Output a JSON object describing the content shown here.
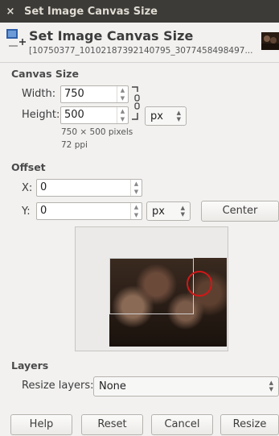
{
  "window": {
    "title": "Set Image Canvas Size",
    "close_glyph": "×"
  },
  "header": {
    "title": "Set Image Canvas Size",
    "subtitle": "[10750377_10102187392140795_3077458498497..."
  },
  "canvas_size": {
    "section_title": "Canvas Size",
    "width_label": "Width:",
    "width_value": "750",
    "height_label": "Height:",
    "height_value": "500",
    "unit": "px",
    "info_pixels": "750 × 500 pixels",
    "info_ppi": "72 ppi"
  },
  "offset": {
    "section_title": "Offset",
    "x_label": "X:",
    "x_value": "0",
    "y_label": "Y:",
    "y_value": "0",
    "unit": "px",
    "center_label": "Center"
  },
  "layers": {
    "section_title": "Layers",
    "resize_label": "Resize layers:",
    "resize_value": "None"
  },
  "buttons": {
    "help": "Help",
    "reset": "Reset",
    "cancel": "Cancel",
    "resize": "Resize"
  },
  "icons": {
    "close": "close-icon",
    "dialog": "canvas-size-icon",
    "chain": "chain-icon",
    "spin": "spin-arrows-icon",
    "thumbnail": "image-thumbnail-icon"
  }
}
